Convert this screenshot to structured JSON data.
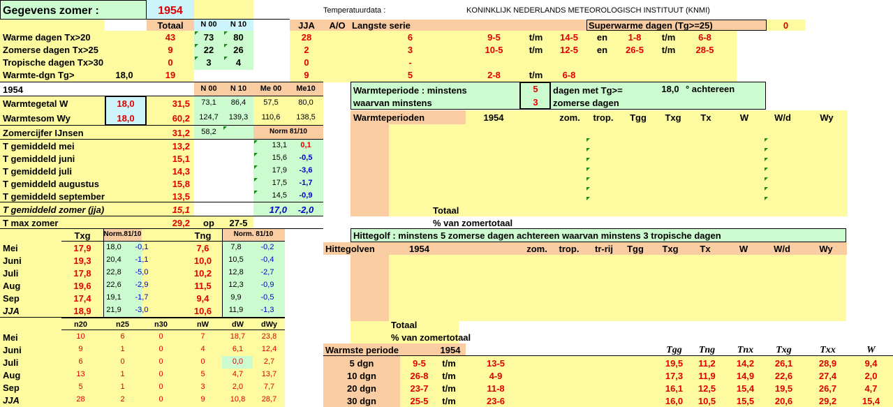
{
  "header": {
    "title": "Gegevens zomer :",
    "year": "1954",
    "temp_label": "Temperatuurdata :",
    "source": "KONINKLIJK NEDERLANDS METEOROLOGISCH INSTITUUT (KNMI)"
  },
  "summary": {
    "col_totaal": "Totaal",
    "col_n00": "N 00",
    "col_n10": "N 10",
    "col_jja": "JJA",
    "col_ao": "A/O",
    "col_langste": "Langste serie",
    "superwarm_label": "Superwarme dagen (Tg>=25)",
    "superwarm_value": "0",
    "rows": [
      {
        "label": "Warme dagen    Tx>20",
        "totaal": "43",
        "n00": "73",
        "n10": "80",
        "jja": "28",
        "ls": "6",
        "from": "9-5",
        "tm": "t/m",
        "to": "14-5",
        "en": "en",
        "from2": "1-8",
        "tm2": "t/m",
        "to2": "6-8"
      },
      {
        "label": "Zomerse dagen   Tx>25",
        "totaal": "9",
        "n00": "22",
        "n10": "26",
        "jja": "2",
        "ls": "3",
        "from": "10-5",
        "tm": "t/m",
        "to": "12-5",
        "en": "en",
        "from2": "26-5",
        "tm2": "t/m",
        "to2": "28-5"
      },
      {
        "label": "Tropische dagen Tx>30",
        "totaal": "0",
        "n00": "3",
        "n10": "4",
        "jja": "0",
        "ls": "-",
        "from": "",
        "tm": "",
        "to": "",
        "en": "",
        "from2": "",
        "tm2": "",
        "to2": ""
      },
      {
        "label": "Warmte-dgn  Tg>",
        "tg": "18,0",
        "totaal": "19",
        "n00": "",
        "n10": "",
        "jja": "9",
        "ls": "5",
        "from": "2-8",
        "tm": "t/m",
        "to": "6-8",
        "en": "",
        "from2": "",
        "tm2": "",
        "to2": ""
      }
    ]
  },
  "warmtegetal": {
    "year": "1954",
    "h_n00": "N 00",
    "h_n10": "N 10",
    "h_me00": "Me 00",
    "h_me10": "Me10",
    "rows": [
      {
        "label": "Warmtegetal W",
        "boxval": "18,0",
        "val": "31,5",
        "n00": "73,1",
        "n10": "86,4",
        "me00": "57,5",
        "me10": "80,0"
      },
      {
        "label": "Warmtesom Wy",
        "boxval": "18,0",
        "val": "60,2",
        "n00": "124,7",
        "n10": "139,3",
        "me00": "110,6",
        "me10": "138,5"
      }
    ],
    "ijnsen_label": "Zomercijfer IJnsen",
    "ijnsen_val": "31,2",
    "ijnsen_n": "58,2",
    "norm_label": "Norm 81/10"
  },
  "tgem": {
    "rows": [
      {
        "label": "T gemiddeld mei",
        "val": "13,2",
        "norm": "13,1",
        "diff": "0,1",
        "diff_color": "red"
      },
      {
        "label": "T gemiddeld juni",
        "val": "15,1",
        "norm": "15,6",
        "diff": "-0,5",
        "diff_color": "blue"
      },
      {
        "label": "T gemiddeld juli",
        "val": "14,3",
        "norm": "17,9",
        "diff": "-3,6",
        "diff_color": "blue"
      },
      {
        "label": "T gemiddeld augustus",
        "val": "15,8",
        "norm": "17,5",
        "diff": "-1,7",
        "diff_color": "blue"
      },
      {
        "label": "T gemiddeld september",
        "val": "13,5",
        "norm": "14,5",
        "diff": "-0,9",
        "diff_color": "blue"
      }
    ],
    "jja_label": "T gemiddeld zomer (jja)",
    "jja_val": "15,1",
    "jja_norm": "17,0",
    "jja_diff": "-2,0",
    "tmax_label": "T max zomer",
    "tmax_val": "29,2",
    "tmax_op": "op",
    "tmax_date": "27-5"
  },
  "monthly": {
    "h_txg": "Txg",
    "h_norm1": "Norm.81/10",
    "h_tng": "Tng",
    "h_norm2": "Norm. 81/10",
    "rows": [
      {
        "m": "Mei",
        "txg": "17,9",
        "n1": "18,0",
        "d1": "-0,1",
        "tng": "7,6",
        "n2": "7,8",
        "d2": "-0,2"
      },
      {
        "m": "Juni",
        "txg": "19,3",
        "n1": "20,4",
        "d1": "-1,1",
        "tng": "10,0",
        "n2": "10,5",
        "d2": "-0,4"
      },
      {
        "m": "Juli",
        "txg": "17,8",
        "n1": "22,8",
        "d1": "-5,0",
        "tng": "10,2",
        "n2": "12,8",
        "d2": "-2,7"
      },
      {
        "m": "Aug",
        "txg": "19,6",
        "n1": "22,6",
        "d1": "-2,9",
        "tng": "11,5",
        "n2": "12,3",
        "d2": "-0,9"
      },
      {
        "m": "Sep",
        "txg": "17,4",
        "n1": "19,1",
        "d1": "-1,7",
        "tng": "9,4",
        "n2": "9,9",
        "d2": "-0,5"
      },
      {
        "m": "JJA",
        "txg": "18,9",
        "n1": "21,9",
        "d1": "-3,0",
        "tng": "10,6",
        "n2": "11,9",
        "d2": "-1,3"
      }
    ]
  },
  "counts": {
    "headers": [
      "n20",
      "n25",
      "n30",
      "nW",
      "dW",
      "dWy"
    ],
    "rows": [
      {
        "m": "Mei",
        "v": [
          "10",
          "6",
          "0",
          "7",
          "18,7",
          "23,8"
        ]
      },
      {
        "m": "Juni",
        "v": [
          "9",
          "1",
          "0",
          "4",
          "6,1",
          "12,4"
        ]
      },
      {
        "m": "Juli",
        "v": [
          "6",
          "0",
          "0",
          "0",
          "0,0",
          "2,7"
        ]
      },
      {
        "m": "Aug",
        "v": [
          "13",
          "1",
          "0",
          "5",
          "4,7",
          "13,7"
        ]
      },
      {
        "m": "Sep",
        "v": [
          "5",
          "1",
          "0",
          "3",
          "2,0",
          "7,7"
        ]
      },
      {
        "m": "JJA",
        "v": [
          "28",
          "2",
          "0",
          "9",
          "10,8",
          "28,7"
        ]
      }
    ]
  },
  "warmteperiode": {
    "line1": "Warmteperiode : minstens",
    "n1": "5",
    "mid1": "dagen met Tg>=",
    "tg": "18,0",
    "unit": "° achtereen",
    "line2": "waarvan minstens",
    "n2": "3",
    "mid2": "zomerse dagen",
    "table_title": "Warmteperioden",
    "year": "1954",
    "headers": [
      "zom.",
      "trop.",
      "Tgg",
      "Txg",
      "Tx",
      "W",
      "W/d",
      "Wy"
    ],
    "totaal": "Totaal",
    "pct": "% van zomertotaal"
  },
  "hittegolf": {
    "definition": "Hittegolf : minstens  5 zomerse dagen achtereen waarvan minstens   3 tropische dagen",
    "table_title": "Hittegolven",
    "year": "1954",
    "headers": [
      "zom.",
      "trop.",
      "tr-rij",
      "Tgg",
      "Txg",
      "Tx",
      "W",
      "W/d",
      "Wy"
    ],
    "totaal": "Totaal",
    "pct": "% van zomertotaal"
  },
  "warmste": {
    "title": "Warmste periode",
    "year": "1954",
    "headers": [
      "Tgg",
      "Tng",
      "Tnx",
      "Txg",
      "Txx",
      "W"
    ],
    "rows": [
      {
        "p": "5 dgn",
        "from": "9-5",
        "tm": "t/m",
        "to": "13-5",
        "v": [
          "19,5",
          "11,2",
          "14,2",
          "26,1",
          "28,9",
          "9,4"
        ]
      },
      {
        "p": "10 dgn",
        "from": "26-8",
        "tm": "t/m",
        "to": "4-9",
        "v": [
          "17,3",
          "11,9",
          "14,9",
          "22,6",
          "27,4",
          "2,0"
        ]
      },
      {
        "p": "20 dgn",
        "from": "23-7",
        "tm": "t/m",
        "to": "11-8",
        "v": [
          "16,1",
          "12,5",
          "15,4",
          "19,5",
          "26,7",
          "4,7"
        ]
      },
      {
        "p": "30 dgn",
        "from": "25-5",
        "tm": "t/m",
        "to": "23-6",
        "v": [
          "16,0",
          "10,5",
          "15,5",
          "20,6",
          "29,2",
          "15,4"
        ]
      }
    ]
  }
}
